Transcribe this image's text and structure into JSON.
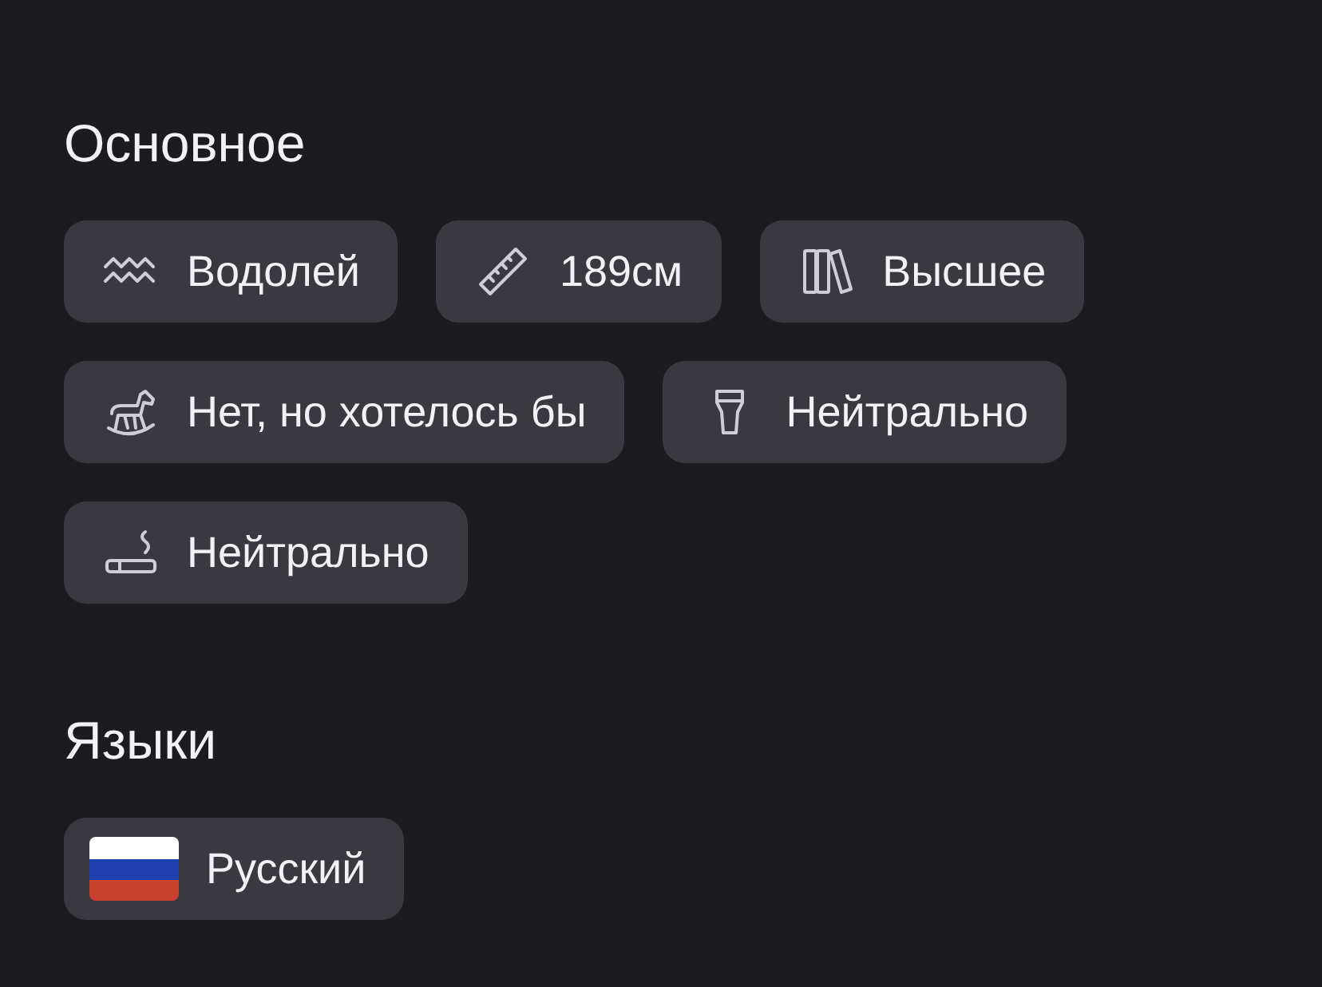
{
  "sections": [
    {
      "title": "Основное",
      "chips": [
        {
          "kind": "aquarius",
          "label": "Водолей"
        },
        {
          "kind": "ruler",
          "label": "189см"
        },
        {
          "kind": "books",
          "label": "Высшее"
        },
        {
          "kind": "horse",
          "label": "Нет, но хотелось бы"
        },
        {
          "kind": "glass",
          "label": "Нейтрально"
        },
        {
          "kind": "cigarette",
          "label": "Нейтрально"
        }
      ]
    },
    {
      "title": "Языки",
      "chips": [
        {
          "kind": "flag",
          "label": "Русский"
        }
      ]
    }
  ]
}
